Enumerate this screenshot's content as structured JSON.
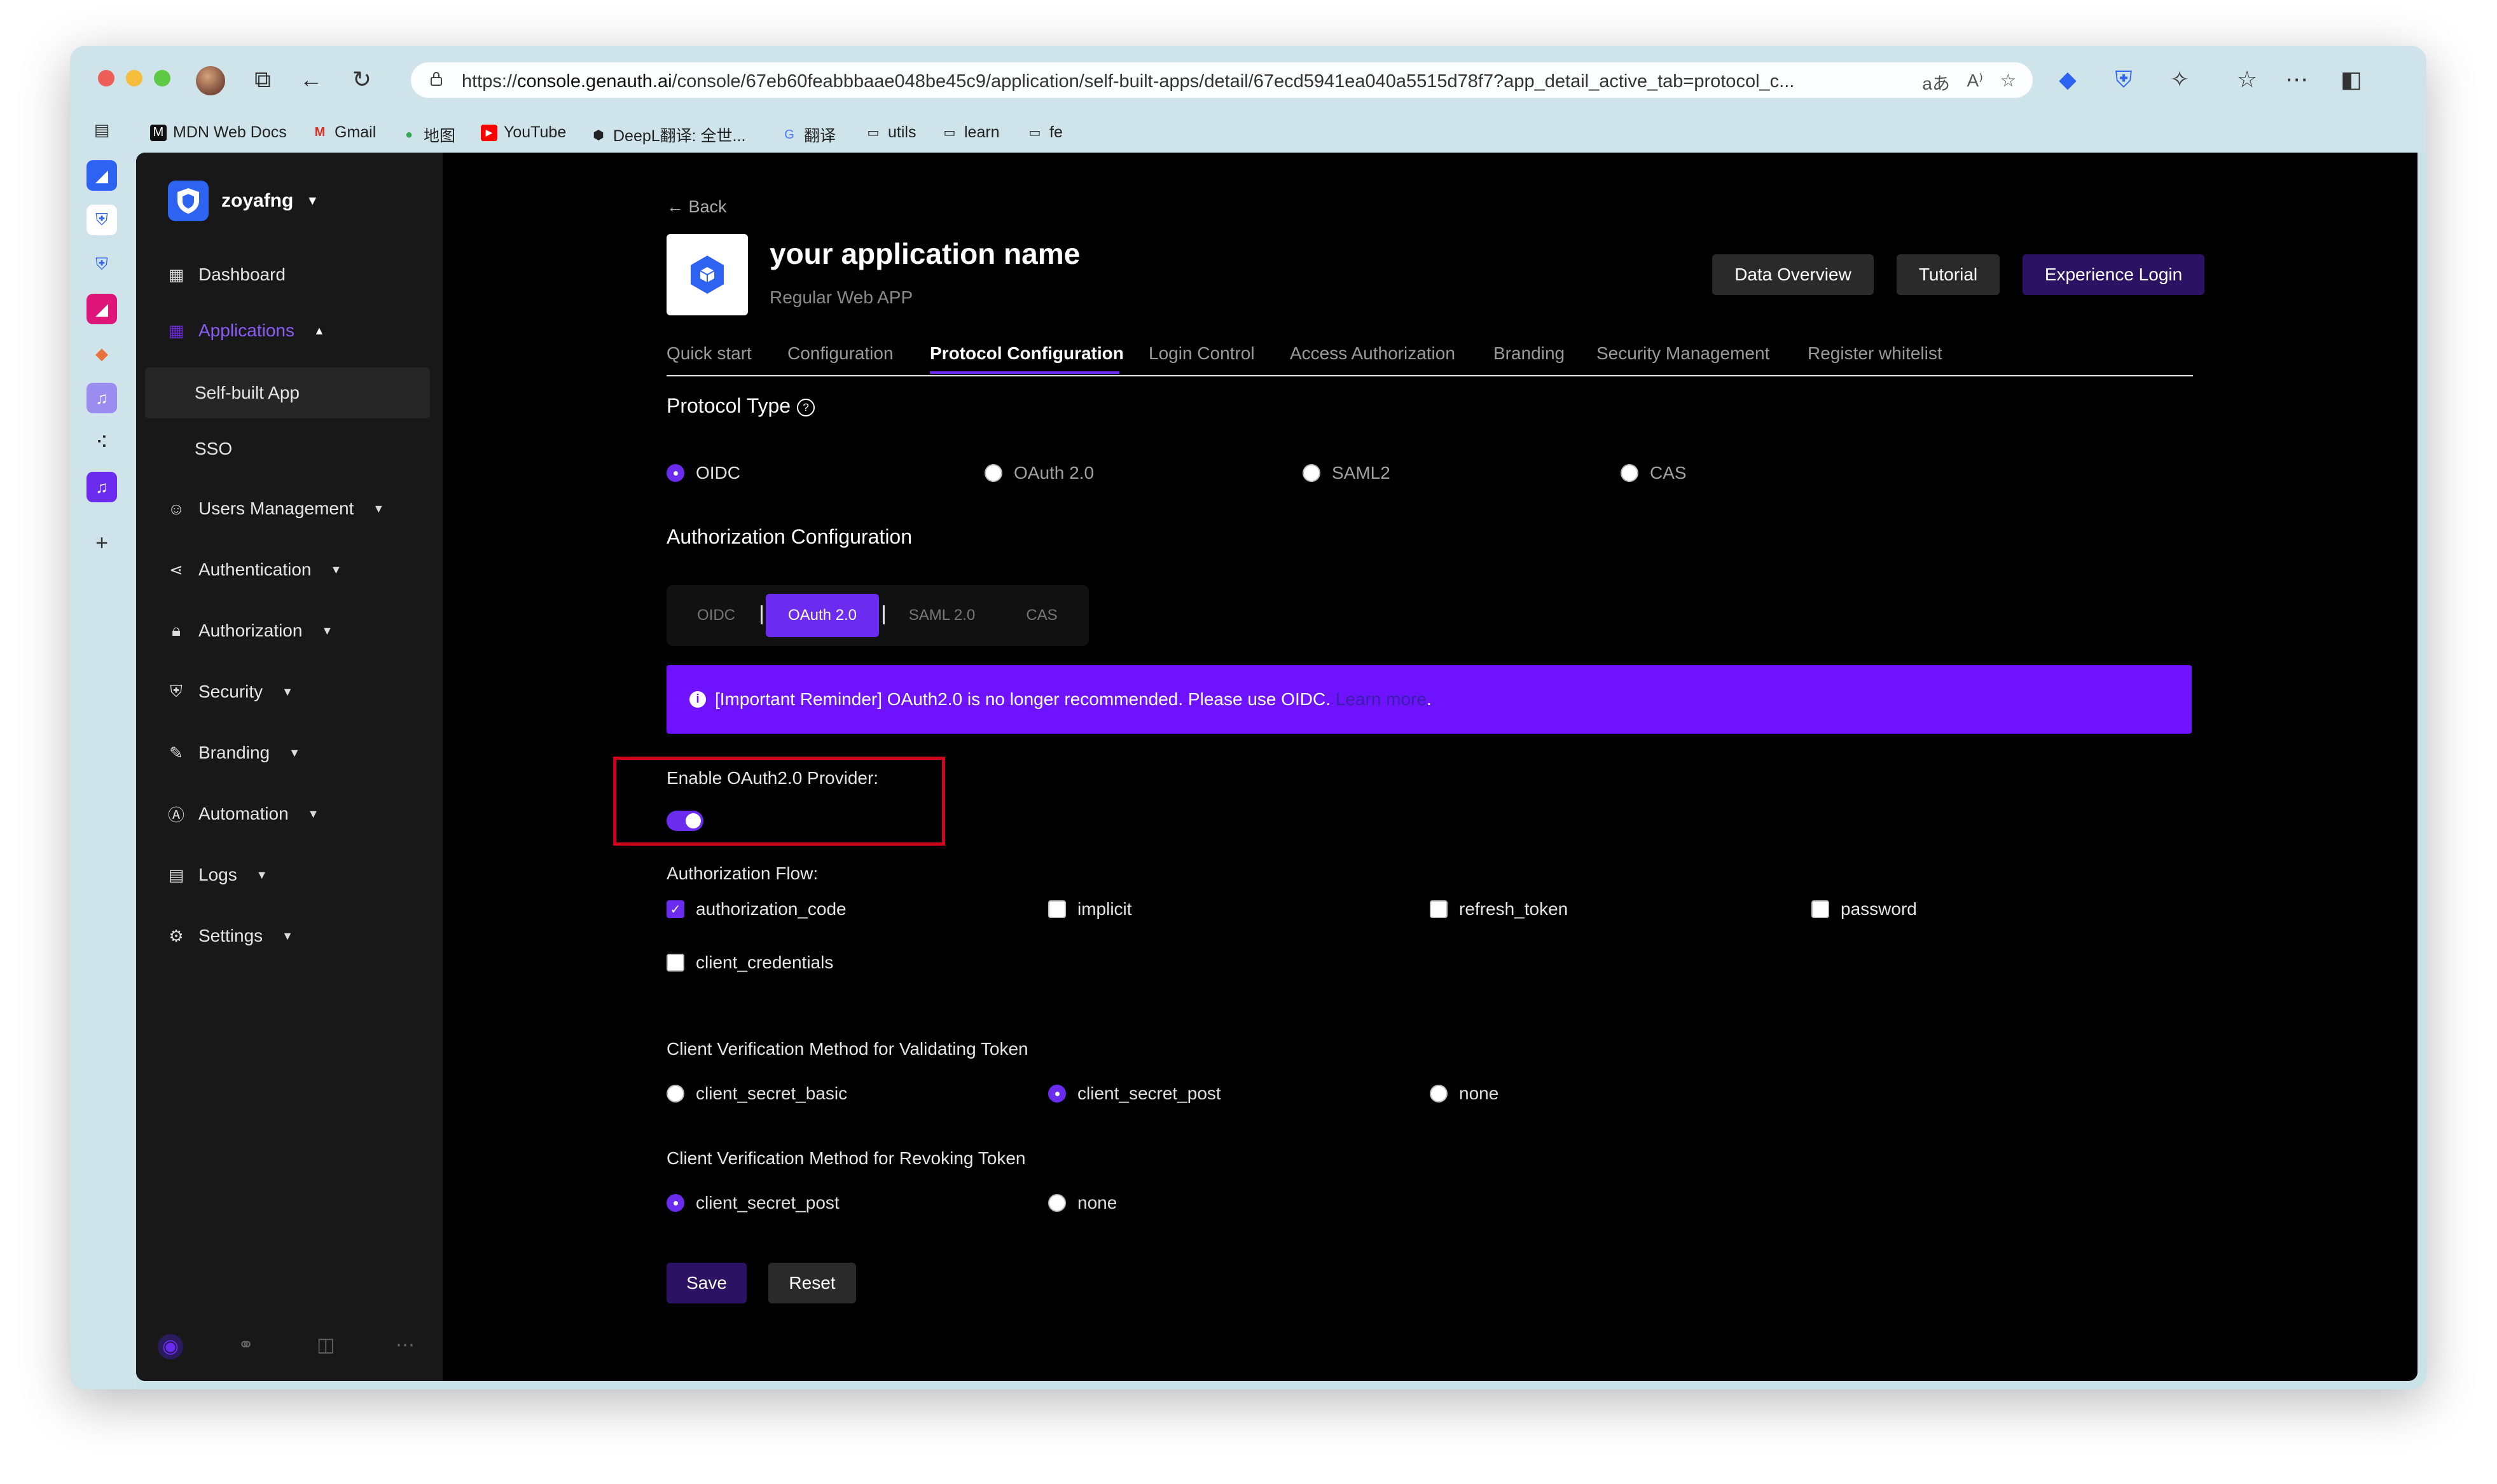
{
  "browser": {
    "url_prefix": "https://",
    "url_host": "console.genauth.ai",
    "url_path": "/console/67eb60feabbbaae048be45c9/application/self-built-apps/detail/67ecd5941ea040a5515d78f7?app_detail_active_tab=protocol_c..."
  },
  "bookmarks": [
    {
      "label": "MDN Web Docs"
    },
    {
      "label": "Gmail"
    },
    {
      "label": "地图"
    },
    {
      "label": "YouTube"
    },
    {
      "label": "DeepL翻译: 全世..."
    },
    {
      "label": "翻译"
    },
    {
      "label": "utils"
    },
    {
      "label": "learn"
    },
    {
      "label": "fe"
    }
  ],
  "org": {
    "name": "zoyafng"
  },
  "sidebar": {
    "items": [
      {
        "label": "Dashboard"
      },
      {
        "label": "Applications"
      },
      {
        "label": "Self-built App"
      },
      {
        "label": "SSO"
      },
      {
        "label": "Users Management"
      },
      {
        "label": "Authentication"
      },
      {
        "label": "Authorization"
      },
      {
        "label": "Security"
      },
      {
        "label": "Branding"
      },
      {
        "label": "Automation"
      },
      {
        "label": "Logs"
      },
      {
        "label": "Settings"
      }
    ]
  },
  "header": {
    "back": "Back",
    "app_name": "your application name",
    "app_type": "Regular Web APP",
    "buttons": {
      "data_overview": "Data Overview",
      "tutorial": "Tutorial",
      "experience_login": "Experience Login"
    }
  },
  "tabs": [
    {
      "label": "Quick start"
    },
    {
      "label": "Configuration"
    },
    {
      "label": "Protocol Configuration"
    },
    {
      "label": "Login Control"
    },
    {
      "label": "Access Authorization"
    },
    {
      "label": "Branding"
    },
    {
      "label": "Security Management"
    },
    {
      "label": "Register whitelist"
    }
  ],
  "active_tab": "Protocol Configuration",
  "protocol_type": {
    "title": "Protocol Type",
    "options": [
      "OIDC",
      "OAuth 2.0",
      "SAML2",
      "CAS"
    ],
    "selected": "OIDC"
  },
  "auth_config": {
    "title": "Authorization Configuration",
    "segments": [
      "OIDC",
      "OAuth 2.0",
      "SAML 2.0",
      "CAS"
    ],
    "selected": "OAuth 2.0"
  },
  "alert": {
    "text": "[Important Reminder] OAuth2.0 is no longer recommended. Please use OIDC.",
    "link": "Learn more",
    "suffix": "."
  },
  "provider": {
    "label": "Enable OAuth2.0 Provider:",
    "enabled": true
  },
  "flow": {
    "label": "Authorization Flow:",
    "options": [
      {
        "label": "authorization_code",
        "checked": true
      },
      {
        "label": "implicit",
        "checked": false
      },
      {
        "label": "refresh_token",
        "checked": false
      },
      {
        "label": "password",
        "checked": false
      },
      {
        "label": "client_credentials",
        "checked": false
      }
    ]
  },
  "validate": {
    "label": "Client Verification Method for Validating Token",
    "options": [
      "client_secret_basic",
      "client_secret_post",
      "none"
    ],
    "selected": "client_secret_post"
  },
  "revoke": {
    "label": "Client Verification Method for Revoking Token",
    "options": [
      "client_secret_post",
      "none"
    ],
    "selected": "client_secret_post"
  },
  "actions": {
    "save": "Save",
    "reset": "Reset"
  },
  "colors": {
    "accent": "#6b2cf0",
    "alert_bg": "#6f12ff",
    "highlight_border": "#d0021b"
  }
}
